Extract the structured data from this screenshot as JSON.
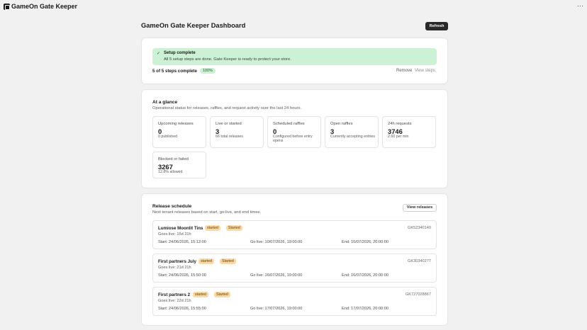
{
  "app": {
    "title": "GameOn Gate Keeper",
    "more": "⋯"
  },
  "page": {
    "title": "GameOn Gate Keeper Dashboard",
    "refresh_label": "Refresh"
  },
  "setup": {
    "banner_title": "Setup complete",
    "banner_text": "All 5 setup steps are done. Gate Keeper is ready to protect your store.",
    "steps_label": "5 of 5 steps complete",
    "percent": "100%",
    "remove_label": "Remove",
    "view_steps_label": "View steps"
  },
  "glance": {
    "title": "At a glance",
    "subtitle": "Operational status for releases, raffles, and request activity over the last 24 hours.",
    "stats": [
      {
        "label": "Upcoming releases",
        "value": "0",
        "note": "0 published"
      },
      {
        "label": "Live or started",
        "value": "3",
        "note": "66 total releases"
      },
      {
        "label": "Scheduled raffles",
        "value": "0",
        "note": "Configured before entry opens"
      },
      {
        "label": "Open raffles",
        "value": "3",
        "note": "Currently accepting entries"
      },
      {
        "label": "24h requests",
        "value": "3746",
        "note": "2.60 per min"
      },
      {
        "label": "Blocked or failed",
        "value": "3267",
        "note": "12.8% allowed"
      }
    ]
  },
  "schedule": {
    "title": "Release schedule",
    "subtitle": "Next tenant releases based on start, go-live, and end times.",
    "view_label": "View releases",
    "releases": [
      {
        "name": "Lumiose Moonlit Tins",
        "badge1": "started",
        "badge2": "Started",
        "id": "GK52340140",
        "goes_live": "Goes live: 15d 21h",
        "start": "Start: 24/06/2026, 15:12:00",
        "golive": "Go live: 10/07/2026, 19:00:00",
        "end": "End: 10/07/2026, 20:00:00"
      },
      {
        "name": "First partners July",
        "badge1": "started",
        "badge2": "Started",
        "id": "GK30340277",
        "goes_live": "Goes live: 21d 21h",
        "start": "Start: 24/06/2026, 15:50:00",
        "golive": "Go live: 16/07/2026, 19:00:00",
        "end": "End: 16/07/2026, 20:00:00"
      },
      {
        "name": "First partners 2",
        "badge1": "started",
        "badge2": "Started",
        "id": "GK727028867",
        "goes_live": "Goes live: 22d 21h",
        "start": "Start: 24/06/2026, 15:55:00",
        "golive": "Go live: 17/07/2026, 19:00:00",
        "end": "End: 17/07/2026, 20:00:00"
      }
    ]
  },
  "icons": {
    "app": "app-logo-icon",
    "check": "check-icon",
    "more": "more-dots-icon"
  }
}
